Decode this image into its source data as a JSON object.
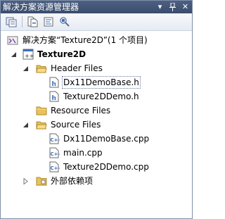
{
  "window": {
    "title": "解决方案资源管理器",
    "dropdown_glyph": "▾",
    "pin_glyph": "ᵜ",
    "close_glyph": "✕"
  },
  "toolbar": {
    "buttons": [
      "properties-icon",
      "show-all-files-icon",
      "view-code-icon",
      "class-diagram-icon"
    ]
  },
  "tree": {
    "solution": "解决方案“Texture2D”(1 个项目)",
    "project": "Texture2D",
    "header_files": "Header Files",
    "header_items": [
      "Dx11DemoBase.h",
      "Texture2DDemo.h"
    ],
    "resource_files": "Resource Files",
    "source_files": "Source Files",
    "source_items": [
      "Dx11DemoBase.cpp",
      "main.cpp",
      "Texture2DDemo.cpp"
    ],
    "external_deps": "外部依赖项"
  },
  "colors": {
    "title_bg": "#455878",
    "folder": "#e8c25a",
    "accent_blue": "#3a6fc4"
  }
}
